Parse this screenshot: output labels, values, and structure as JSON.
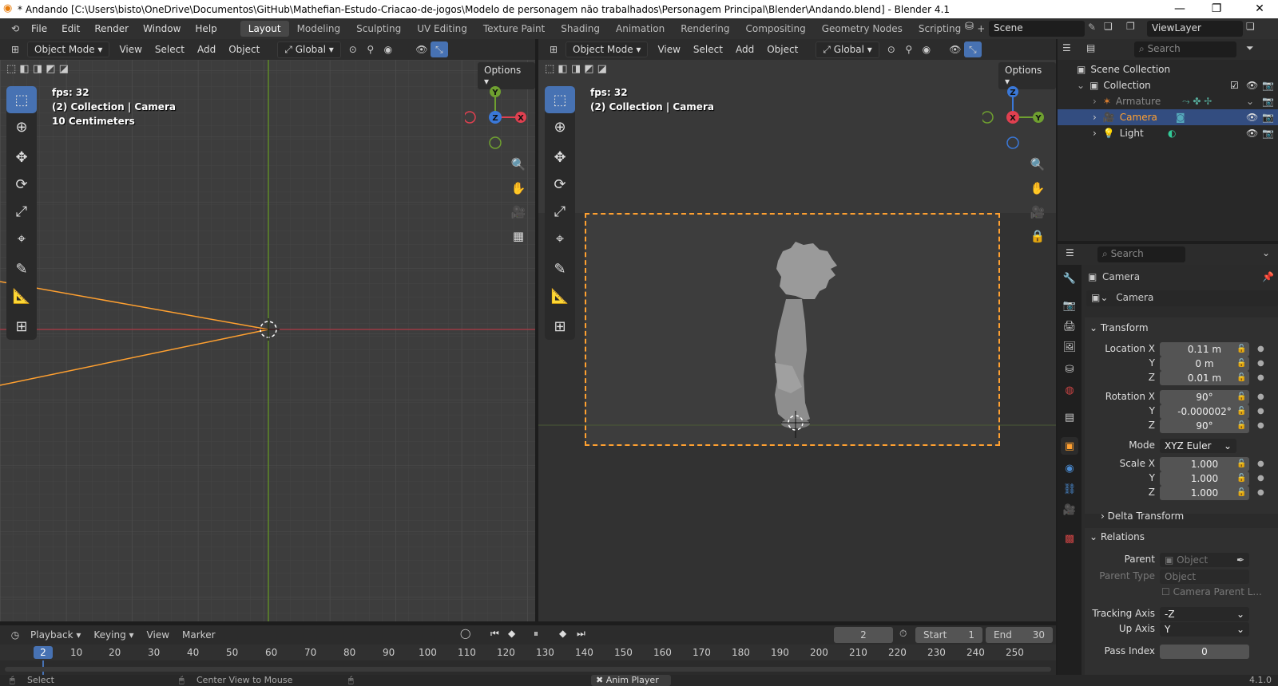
{
  "window": {
    "title": "* Andando [C:\\Users\\bisto\\OneDrive\\Documentos\\GitHub\\Mathefian-Estudo-Criacao-de-jogos\\Modelo de personagem não trabalhados\\Personagem Principal\\Blender\\Andando.blend] - Blender 4.1",
    "minimize": "—",
    "maximize": "❐",
    "close": "✕"
  },
  "menus": [
    "File",
    "Edit",
    "Render",
    "Window",
    "Help"
  ],
  "workspaces": [
    "Layout",
    "Modeling",
    "Sculpting",
    "UV Editing",
    "Texture Paint",
    "Shading",
    "Animation",
    "Rendering",
    "Compositing",
    "Geometry Nodes",
    "Scripting"
  ],
  "workspace_add": "+",
  "scene": {
    "name": "Scene",
    "view_layer": "ViewLayer"
  },
  "left_viewport": {
    "mode": "Object Mode",
    "menus": [
      "View",
      "Select",
      "Add",
      "Object"
    ],
    "orientation": "Global",
    "options": "Options",
    "overlay": [
      "fps: 32",
      "(2) Collection | Camera",
      "10 Centimeters"
    ],
    "gizmo": {
      "y": "Y",
      "z": "Z",
      "x": "X"
    }
  },
  "right_viewport": {
    "mode": "Object Mode",
    "menus": [
      "View",
      "Select",
      "Add",
      "Object"
    ],
    "orientation": "Global",
    "options": "Options",
    "overlay": [
      "fps: 32",
      "(2) Collection | Camera"
    ],
    "gizmo": {
      "z": "Z",
      "x": "X",
      "y": "Y"
    }
  },
  "outliner": {
    "search_placeholder": "Search",
    "scene_collection": "Scene Collection",
    "collection": "Collection",
    "items": [
      "Armature",
      "Camera",
      "Light"
    ]
  },
  "properties": {
    "search_placeholder": "Search",
    "object_name": "Camera",
    "data_name": "Camera",
    "transform": {
      "header": "Transform",
      "location_label": "Location X",
      "rotation_label": "Rotation X",
      "scale_label": "Scale X",
      "y_label": "Y",
      "z_label": "Z",
      "location": [
        "0.11 m",
        "0 m",
        "0.01 m"
      ],
      "rotation": [
        "90°",
        "-0.000002°",
        "90°"
      ],
      "mode_label": "Mode",
      "mode": "XYZ Euler",
      "scale": [
        "1.000",
        "1.000",
        "1.000"
      ]
    },
    "delta_transform": "Delta Transform",
    "relations": {
      "header": "Relations",
      "parent_label": "Parent",
      "parent_placeholder": "Object",
      "parent_type_label": "Parent Type",
      "parent_type": "Object",
      "camera_parent_lock": "Camera Parent L...",
      "tracking_axis_label": "Tracking Axis",
      "tracking_axis": "-Z",
      "up_axis_label": "Up Axis",
      "up_axis": "Y",
      "pass_index_label": "Pass Index",
      "pass_index": "0"
    }
  },
  "timeline": {
    "menus": [
      "Playback",
      "Keying",
      "View",
      "Marker"
    ],
    "current_frame": "2",
    "start_label": "Start",
    "start": "1",
    "end_label": "End",
    "end": "30",
    "ruler": [
      "2",
      "10",
      "20",
      "30",
      "40",
      "50",
      "60",
      "70",
      "80",
      "90",
      "100",
      "110",
      "120",
      "130",
      "140",
      "150",
      "160",
      "170",
      "180",
      "190",
      "200",
      "210",
      "220",
      "230",
      "240",
      "250"
    ]
  },
  "statusbar": {
    "select": "Select",
    "center_view": "Center View to Mouse",
    "anim_player": "Anim Player",
    "version": "4.1.0"
  },
  "colors": {
    "accent_blue": "#4772b3",
    "selected_orange": "#ffa030",
    "axis_red": "#e04050",
    "axis_green": "#6fa030",
    "axis_blue": "#3a78d8"
  }
}
